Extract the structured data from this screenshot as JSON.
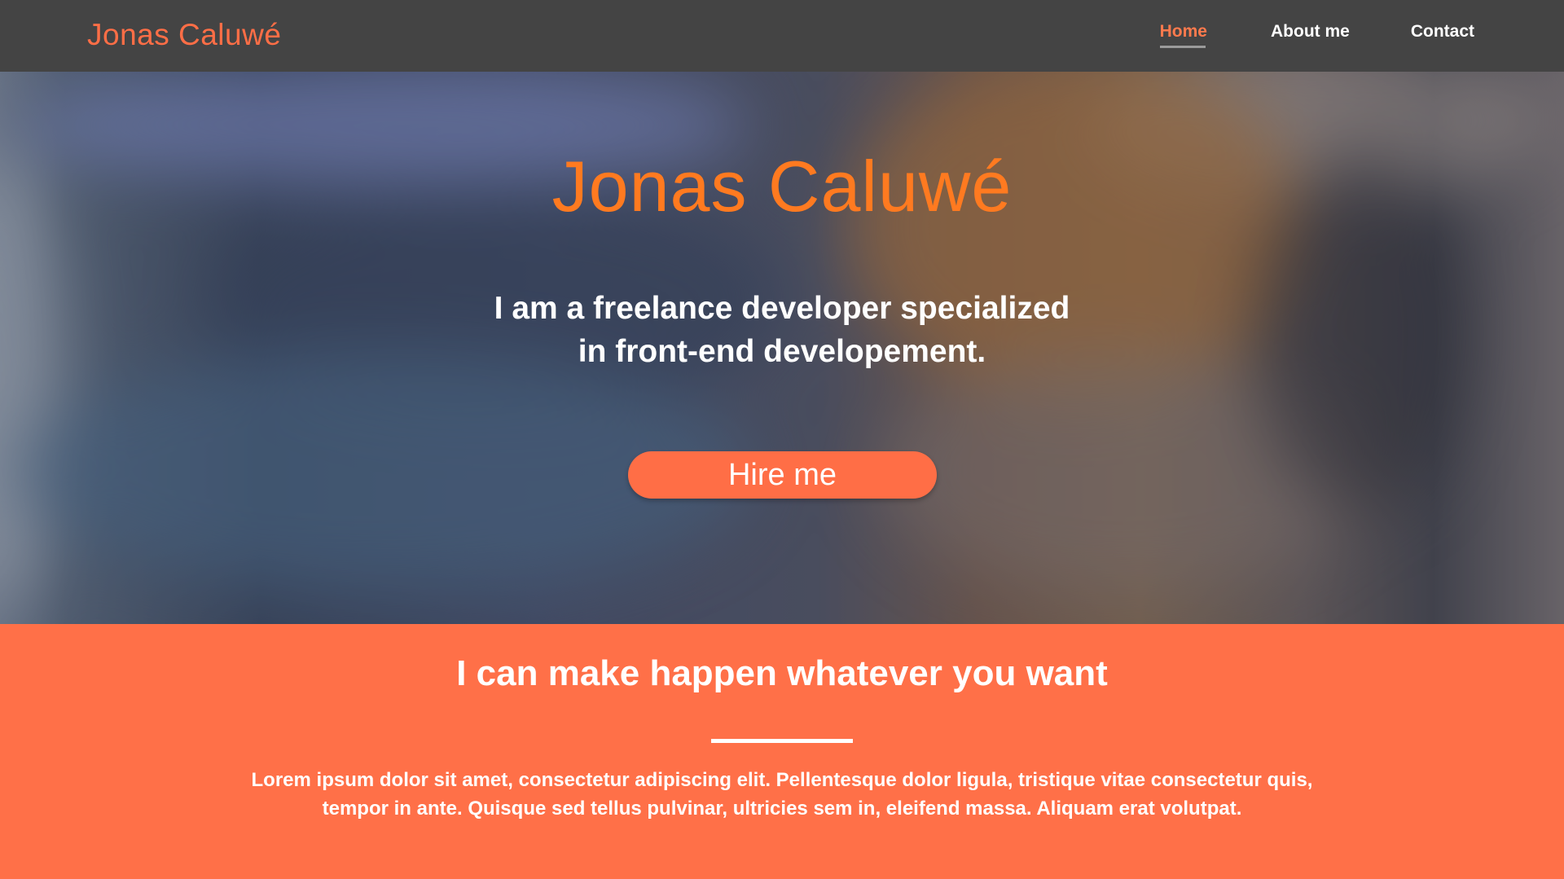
{
  "nav": {
    "brand": "Jonas Caluwé",
    "links": [
      {
        "label": "Home",
        "active": true
      },
      {
        "label": "About me",
        "active": false
      },
      {
        "label": "Contact",
        "active": false
      }
    ]
  },
  "hero": {
    "title": "Jonas Caluwé",
    "subtitle_line1": "I am a freelance developer specialized",
    "subtitle_line2": "in front-end developement.",
    "cta_label": "Hire me"
  },
  "section": {
    "title": "I  can make happen whatever you want",
    "body": "Lorem ipsum dolor sit amet, consectetur adipiscing elit. Pellentesque dolor ligula, tristique vitae consectetur quis, tempor in ante. Quisque sed tellus pulvinar, ultricies sem in, eleifend massa. Aliquam erat volutpat."
  },
  "colors": {
    "accent": "#ff6e46",
    "navbar": "#444444",
    "hero_title": "#ff7a20",
    "section_bg": "#ff7048"
  }
}
